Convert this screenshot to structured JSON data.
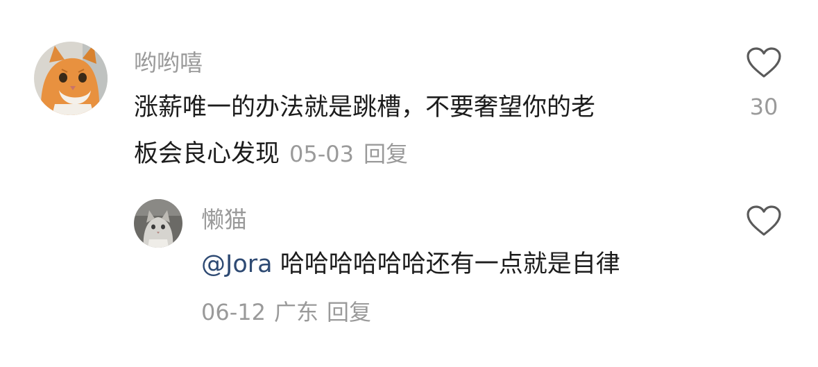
{
  "comment": {
    "username": "哟哟嘻",
    "text_line1": "涨薪唯一的办法就是跳槽，不要奢望你的老",
    "text_line2": "板会良心发现",
    "date": "05-03",
    "reply_label": "回复",
    "like_count": "30",
    "like_icon": "heart-outline-icon",
    "avatar_desc": "orange-cat-avatar",
    "reply": {
      "username": "懒猫",
      "mention": "@Jora",
      "text": "哈哈哈哈哈哈还有一点就是自律",
      "date": "06-12",
      "location": "广东",
      "reply_label": "回复",
      "like_icon": "heart-outline-icon",
      "avatar_desc": "grey-cat-avatar"
    }
  },
  "colors": {
    "text_primary": "#1c1c1c",
    "text_secondary": "#9a9a9a",
    "mention": "#2e4a73",
    "icon": "#5a5a5a"
  }
}
